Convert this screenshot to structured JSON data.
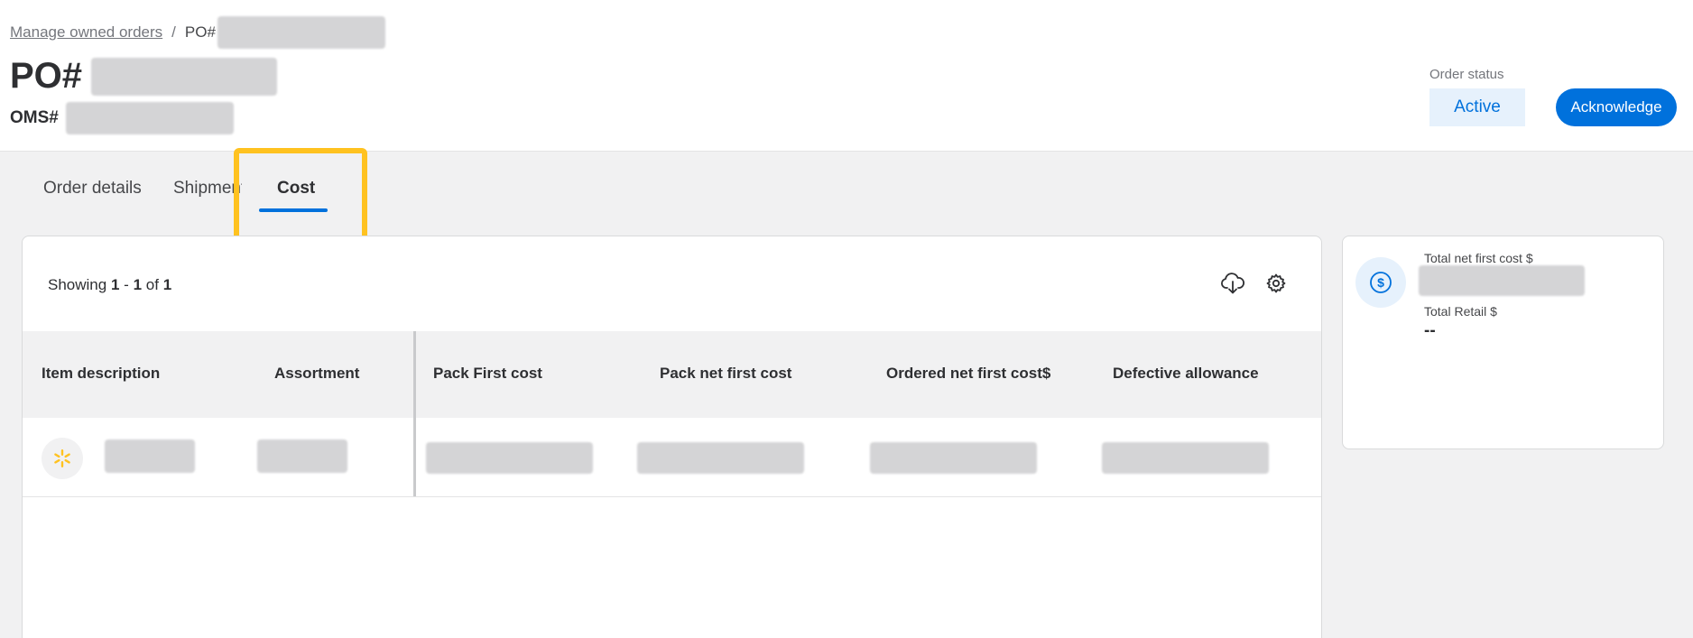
{
  "breadcrumb": {
    "parent": "Manage owned orders",
    "separator": "/",
    "current_prefix": "PO#"
  },
  "header": {
    "title_prefix": "PO#",
    "oms_prefix": "OMS#"
  },
  "status": {
    "label": "Order status",
    "value": "Active"
  },
  "actions": {
    "acknowledge": "Acknowledge"
  },
  "tabs": [
    {
      "label": "Order details"
    },
    {
      "label": "Shipments"
    },
    {
      "label": "Cost"
    }
  ],
  "table": {
    "showing": {
      "prefix": "Showing",
      "from": "1",
      "dash": "-",
      "to": "1",
      "of": "of",
      "total": "1"
    },
    "columns": [
      "Item description",
      "Assortment",
      "Pack First cost",
      "Pack net first cost",
      "Ordered net first cost$",
      "Defective allowance"
    ]
  },
  "summary": {
    "total_net_first_cost_label": "Total net first cost $",
    "total_retail_label": "Total Retail $",
    "total_retail_value": "--"
  },
  "colors": {
    "accent": "#0071dc",
    "highlight": "#ffc220",
    "spark": "#ffc220"
  },
  "icons": [
    "cloud-download-icon",
    "gear-icon",
    "dollar-icon",
    "spark-icon"
  ]
}
